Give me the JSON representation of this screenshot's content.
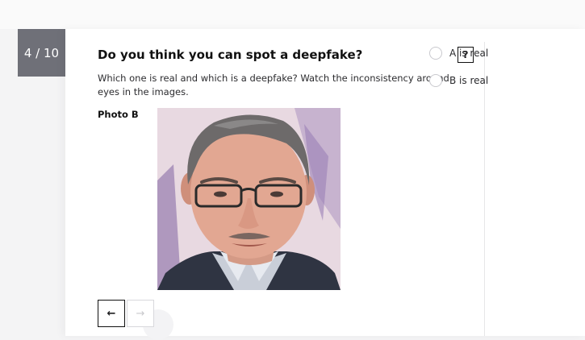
{
  "progress": {
    "label": "4 / 10",
    "current": 4,
    "total": 10
  },
  "question": {
    "title": "Do you think you can spot a deepfake?",
    "help_label": "?",
    "description": "Which one is real and which is a deepfake? Watch the inconsistency around eyes in the images.",
    "photo_label": "Photo B"
  },
  "navigation": {
    "prev_icon": "←",
    "next_icon": "→"
  },
  "options": [
    {
      "label": "A is real"
    },
    {
      "label": "B is real"
    }
  ],
  "colors": {
    "counter_bg": "#6f7078",
    "accent": "#111111",
    "radio_border": "#c9c9ce"
  }
}
